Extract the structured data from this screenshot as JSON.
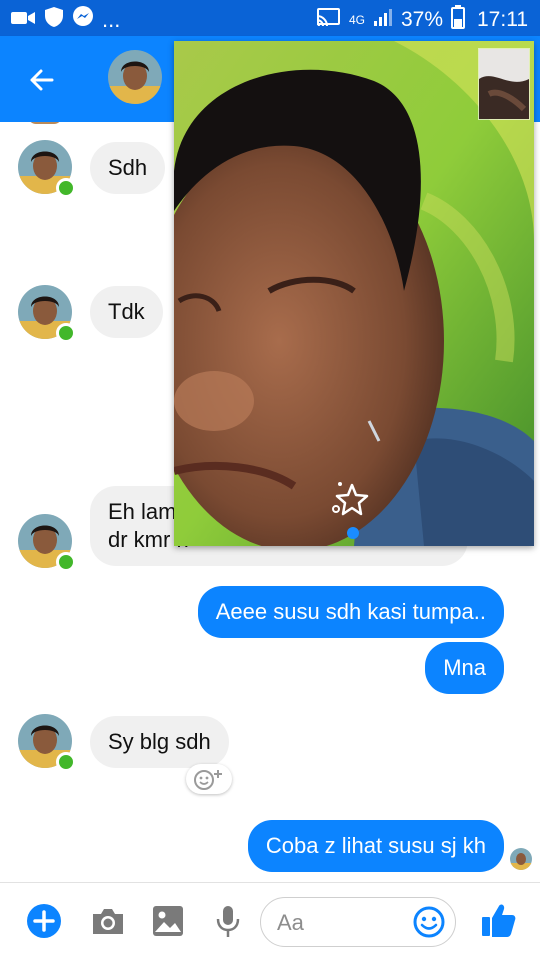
{
  "status_bar": {
    "network": "4G",
    "battery_percent": "37%",
    "time": "17:11",
    "overflow": "...",
    "icons": [
      "video-call-icon",
      "shield-icon",
      "messenger-icon",
      "cast-icon",
      "signal-icon",
      "battery-icon"
    ]
  },
  "header": {
    "icons": [
      "back-arrow-icon"
    ]
  },
  "messages": [
    {
      "direction": "in",
      "text": "Sdh"
    },
    {
      "direction": "in",
      "text": "Tdk"
    },
    {
      "direction": "in",
      "text": "Eh lam",
      "text_line2": "dr kmr n"
    },
    {
      "direction": "out",
      "text": "Aeee susu sdh kasi tumpa.."
    },
    {
      "direction": "out",
      "text": "Mna"
    },
    {
      "direction": "in",
      "text": "Sy blg sdh"
    },
    {
      "direction": "out",
      "text": "Coba z lihat susu sj kh"
    }
  ],
  "video_call": {
    "icons": [
      "effects-sparkle-icon",
      "page-dot-indicator"
    ]
  },
  "composer": {
    "placeholder": "Aa",
    "icons": [
      "add-icon",
      "camera-icon",
      "gallery-icon",
      "microphone-icon",
      "emoji-icon",
      "thumbs-up-icon"
    ]
  },
  "colors": {
    "brand_blue": "#0c84ff",
    "status_bar": "#0a63d6",
    "incoming_bubble": "#f0f0f0",
    "online_green": "#42b72a"
  }
}
